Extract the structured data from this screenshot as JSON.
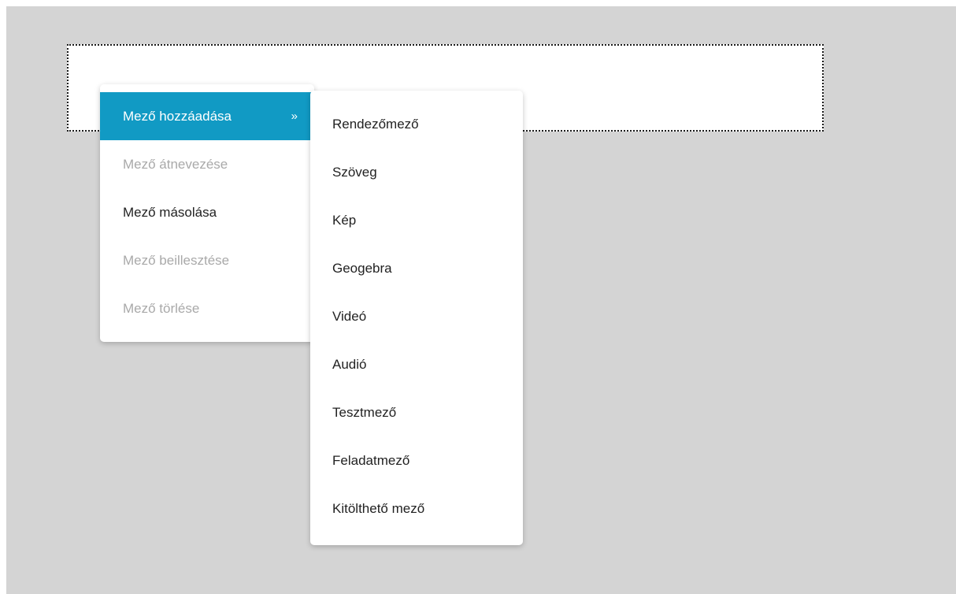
{
  "main_menu": {
    "items": [
      {
        "label": "Mező hozzáadása",
        "state": "active",
        "submenu_indicator": "»"
      },
      {
        "label": "Mező átnevezése",
        "state": "disabled"
      },
      {
        "label": "Mező másolása",
        "state": "enabled"
      },
      {
        "label": "Mező beillesztése",
        "state": "disabled"
      },
      {
        "label": "Mező törlése",
        "state": "disabled"
      }
    ]
  },
  "sub_menu": {
    "items": [
      {
        "label": "Rendezőmező"
      },
      {
        "label": "Szöveg"
      },
      {
        "label": "Kép"
      },
      {
        "label": "Geogebra"
      },
      {
        "label": "Videó"
      },
      {
        "label": "Audió"
      },
      {
        "label": "Tesztmező"
      },
      {
        "label": "Feladatmező"
      },
      {
        "label": "Kitölthető mező"
      }
    ]
  },
  "colors": {
    "accent": "#119ac4",
    "disabled_text": "#a9a9a9",
    "canvas_background": "#d4d4d4"
  }
}
